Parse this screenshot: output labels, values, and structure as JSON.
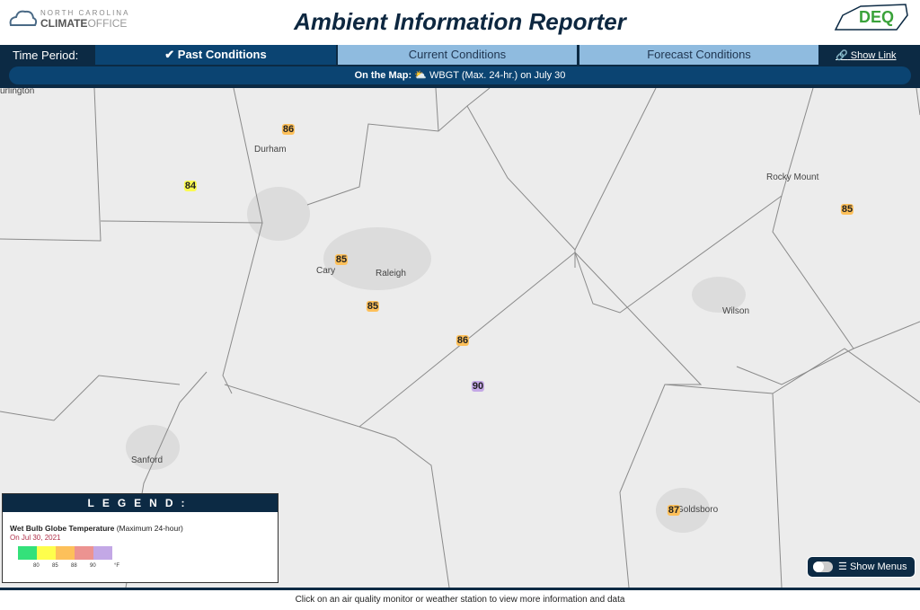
{
  "header": {
    "title": "Ambient Information Reporter",
    "logo_left_line1": "NORTH CAROLINA",
    "logo_left_line2a": "CLIMATE",
    "logo_left_line2b": "OFFICE",
    "logo_right": "DEQ"
  },
  "nav": {
    "time_period_label": "Time Period:",
    "tabs": [
      {
        "label": "Past Conditions",
        "active": true
      },
      {
        "label": "Current Conditions",
        "active": false
      },
      {
        "label": "Forecast Conditions",
        "active": false
      }
    ],
    "show_link": "Show Link",
    "on_map_label": "On the Map:",
    "on_map_value": "WBGT (Max. 24-hr.) on July 30"
  },
  "map": {
    "cities": [
      "urlington",
      "Durham",
      "Cary",
      "Raleigh",
      "Rocky Mount",
      "Wilson",
      "Sanford",
      "Goldsboro"
    ],
    "markers": [
      {
        "value": "86",
        "color": "#fdc05a"
      },
      {
        "value": "84",
        "color": "#fbfb4f"
      },
      {
        "value": "85",
        "color": "#fdc05a"
      },
      {
        "value": "85",
        "color": "#fdc05a"
      },
      {
        "value": "86",
        "color": "#fdc05a"
      },
      {
        "value": "90",
        "color": "#c4a8e6"
      },
      {
        "value": "85",
        "color": "#fdc05a"
      },
      {
        "value": "87",
        "color": "#fdc05a"
      }
    ]
  },
  "legend": {
    "heading": "LEGEND:",
    "title": "Wet Bulb Globe Temperature",
    "subtitle": "(Maximum 24-hour)",
    "date": "On Jul 30, 2021",
    "colors": [
      "#34e17a",
      "#fefe4c",
      "#fdc05a",
      "#ec9391",
      "#c3a8e6"
    ],
    "ticks": [
      "80",
      "85",
      "88",
      "90"
    ],
    "unit": "°F"
  },
  "show_menus": "Show Menus",
  "status_bar": "Click on an air quality monitor or weather station to view more information and data"
}
